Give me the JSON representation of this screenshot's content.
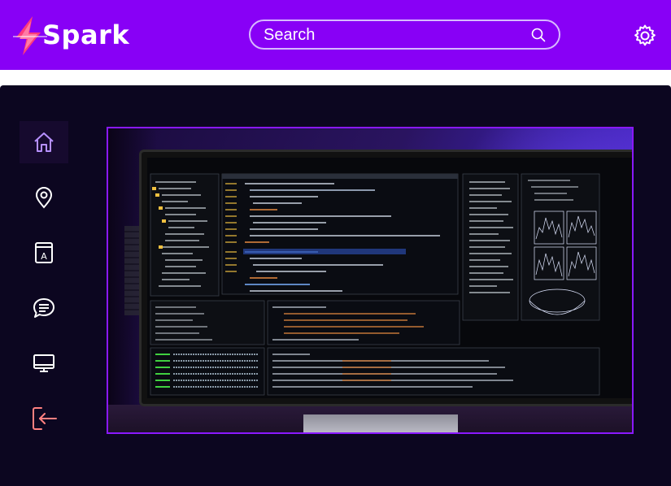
{
  "app": {
    "logo_text": "Spark",
    "brand_color": "#8800f6"
  },
  "search": {
    "placeholder": "Search",
    "icon": "search-icon"
  },
  "header": {
    "settings_icon": "gear-icon"
  },
  "sidebar": {
    "items": [
      {
        "icon": "home-icon",
        "active": true
      },
      {
        "icon": "location-pin-icon",
        "active": false
      },
      {
        "icon": "dictionary-icon",
        "active": false
      },
      {
        "icon": "chat-icon",
        "active": false
      },
      {
        "icon": "monitor-icon",
        "active": false
      },
      {
        "icon": "logout-icon",
        "active": false
      }
    ]
  },
  "hero": {
    "description_icon": "programmer-monitor-photo"
  }
}
